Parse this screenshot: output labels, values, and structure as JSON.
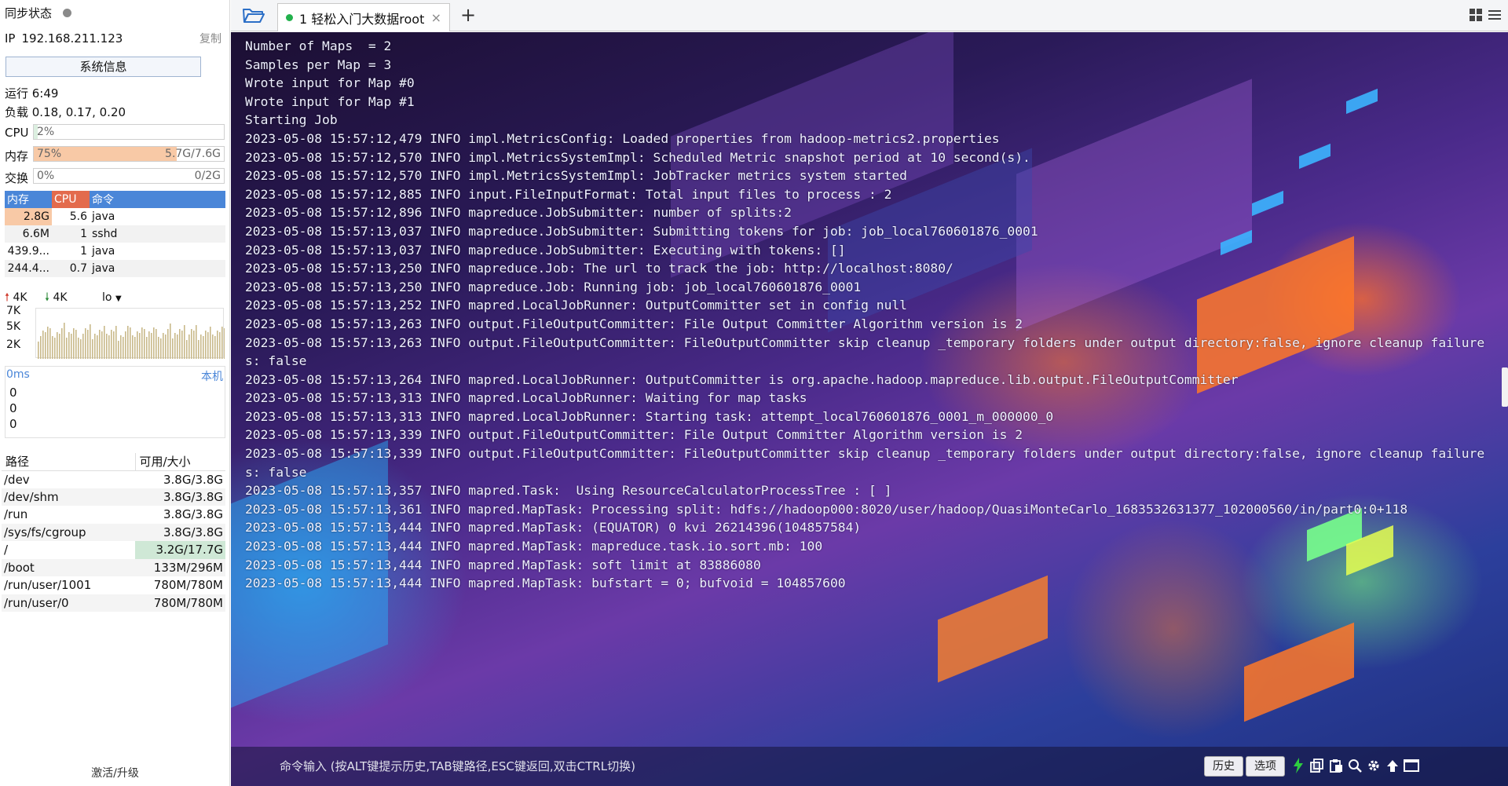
{
  "sidebar": {
    "sync_label": "同步状态",
    "ip_label": "IP",
    "ip_value": "192.168.211.123",
    "copy_label": "复制",
    "sysinfo_button": "系统信息",
    "uptime": "运行 6:49",
    "load": "负载 0.18, 0.17, 0.20",
    "cpu": {
      "label": "CPU",
      "percent": "2%",
      "fraction": 0.02
    },
    "mem": {
      "label": "内存",
      "percent": "75%",
      "amount": "5.7G/7.6G",
      "fraction": 0.75
    },
    "swap": {
      "label": "交换",
      "percent": "0%",
      "amount": "0/2G",
      "fraction": 0.0
    },
    "proc_headers": [
      "内存",
      "CPU",
      "命令"
    ],
    "processes": [
      {
        "mem": "2.8G",
        "cpu": "5.6",
        "cmd": "java"
      },
      {
        "mem": "6.6M",
        "cpu": "1",
        "cmd": "sshd"
      },
      {
        "mem": "439.9...",
        "cpu": "1",
        "cmd": "java"
      },
      {
        "mem": "244.4...",
        "cpu": "0.7",
        "cmd": "java"
      }
    ],
    "net": {
      "up": "4K",
      "down": "4K",
      "iface": "lo",
      "axis": [
        "7K",
        "5K",
        "2K"
      ]
    },
    "latency": {
      "ms": "0ms",
      "host": "本机",
      "values": [
        "0",
        "0",
        "0"
      ]
    },
    "disk_headers": [
      "路径",
      "可用/大小"
    ],
    "disks": [
      {
        "path": "/dev",
        "size": "3.8G/3.8G"
      },
      {
        "path": "/dev/shm",
        "size": "3.8G/3.8G"
      },
      {
        "path": "/run",
        "size": "3.8G/3.8G"
      },
      {
        "path": "/sys/fs/cgroup",
        "size": "3.8G/3.8G"
      },
      {
        "path": "/",
        "size": "3.2G/17.7G"
      },
      {
        "path": "/boot",
        "size": "133M/296M"
      },
      {
        "path": "/run/user/1001",
        "size": "780M/780M"
      },
      {
        "path": "/run/user/0",
        "size": "780M/780M"
      }
    ],
    "upgrade": "激活/升级"
  },
  "tabs": [
    {
      "label": "1 轻松入门大数据root",
      "active": true,
      "status_color": "#22b14c"
    }
  ],
  "terminal": {
    "lines": [
      "Number of Maps  = 2",
      "Samples per Map = 3",
      "Wrote input for Map #0",
      "Wrote input for Map #1",
      "Starting Job",
      "2023-05-08 15:57:12,479 INFO impl.MetricsConfig: Loaded properties from hadoop-metrics2.properties",
      "2023-05-08 15:57:12,570 INFO impl.MetricsSystemImpl: Scheduled Metric snapshot period at 10 second(s).",
      "2023-05-08 15:57:12,570 INFO impl.MetricsSystemImpl: JobTracker metrics system started",
      "2023-05-08 15:57:12,885 INFO input.FileInputFormat: Total input files to process : 2",
      "2023-05-08 15:57:12,896 INFO mapreduce.JobSubmitter: number of splits:2",
      "2023-05-08 15:57:13,037 INFO mapreduce.JobSubmitter: Submitting tokens for job: job_local760601876_0001",
      "2023-05-08 15:57:13,037 INFO mapreduce.JobSubmitter: Executing with tokens: []",
      "2023-05-08 15:57:13,250 INFO mapreduce.Job: The url to track the job: http://localhost:8080/",
      "2023-05-08 15:57:13,250 INFO mapreduce.Job: Running job: job_local760601876_0001",
      "2023-05-08 15:57:13,252 INFO mapred.LocalJobRunner: OutputCommitter set in config null",
      "2023-05-08 15:57:13,263 INFO output.FileOutputCommitter: File Output Committer Algorithm version is 2",
      "2023-05-08 15:57:13,263 INFO output.FileOutputCommitter: FileOutputCommitter skip cleanup _temporary folders under output directory:false, ignore cleanup failures: false",
      "2023-05-08 15:57:13,264 INFO mapred.LocalJobRunner: OutputCommitter is org.apache.hadoop.mapreduce.lib.output.FileOutputCommitter",
      "2023-05-08 15:57:13,313 INFO mapred.LocalJobRunner: Waiting for map tasks",
      "2023-05-08 15:57:13,313 INFO mapred.LocalJobRunner: Starting task: attempt_local760601876_0001_m_000000_0",
      "2023-05-08 15:57:13,339 INFO output.FileOutputCommitter: File Output Committer Algorithm version is 2",
      "2023-05-08 15:57:13,339 INFO output.FileOutputCommitter: FileOutputCommitter skip cleanup _temporary folders under output directory:false, ignore cleanup failures: false",
      "2023-05-08 15:57:13,357 INFO mapred.Task:  Using ResourceCalculatorProcessTree : [ ]",
      "2023-05-08 15:57:13,361 INFO mapred.MapTask: Processing split: hdfs://hadoop000:8020/user/hadoop/QuasiMonteCarlo_1683532631377_102000560/in/part0:0+118",
      "2023-05-08 15:57:13,444 INFO mapred.MapTask: (EQUATOR) 0 kvi 26214396(104857584)",
      "2023-05-08 15:57:13,444 INFO mapred.MapTask: mapreduce.task.io.sort.mb: 100",
      "2023-05-08 15:57:13,444 INFO mapred.MapTask: soft limit at 83886080",
      "2023-05-08 15:57:13,444 INFO mapred.MapTask: bufstart = 0; bufvoid = 104857600"
    ],
    "command_placeholder": "命令输入 (按ALT键提示历史,TAB键路径,ESC键返回,双击CTRL切换)",
    "history_button": "历史",
    "options_button": "选项"
  },
  "icons": {
    "folder": "folder-open-icon",
    "add_tab": "+",
    "close_tab": "×",
    "grid": "grid-icon",
    "menu": "menu-icon",
    "lightning": "lightning-icon",
    "copy": "copy-icon",
    "paste": "paste-icon",
    "search": "search-icon",
    "settings": "gear-icon",
    "up": "arrow-up-icon",
    "window": "window-icon"
  },
  "colors": {
    "accent_blue": "#4a86d8",
    "cpu_header": "#e36b4d",
    "mem_bar": "#f8c9a6",
    "active_dot": "#22b14c",
    "lightning": "#2ecc40"
  }
}
